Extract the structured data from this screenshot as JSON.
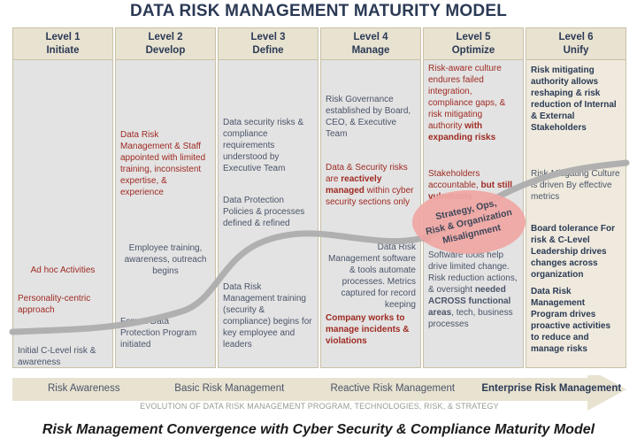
{
  "title": "DATA RISK MANAGEMENT MATURITY MODEL",
  "footer": "Risk Management Convergence with Cyber Security & Compliance Maturity Model",
  "colors": {
    "header_bg": "#e8e2d0",
    "cell_bg": "#e3e3e3",
    "last_cell_bg": "#efeadd",
    "border": "#c9c0a6",
    "navy": "#2b3a55",
    "red": "#9e2a22",
    "gray_text": "#4a5468",
    "ellipse": "#f0a7a4",
    "curve": "#b0b0b0",
    "arrow_bg": "#e8e2d0"
  },
  "columns": [
    {
      "level": "Level 1",
      "name": "Initiate",
      "blocks": [
        {
          "text": "Ad hoc Activities",
          "style": "red",
          "align": "center"
        },
        {
          "text": "Personality-centric approach",
          "style": "red",
          "align": "left"
        },
        {
          "text": "Initial C-Level risk & awareness",
          "style": "gray",
          "align": "left"
        }
      ]
    },
    {
      "level": "Level 2",
      "name": "Develop",
      "blocks": [
        {
          "text": "Data Risk Management & Staff appointed with limited training, inconsistent expertise, & experience",
          "style": "red",
          "align": "left"
        },
        {
          "text": "Employee training, awareness, outreach begins",
          "style": "gray",
          "align": "center"
        },
        {
          "text": "Formal Data Protection Program initiated",
          "style": "gray",
          "align": "left"
        }
      ]
    },
    {
      "level": "Level 3",
      "name": "Define",
      "blocks": [
        {
          "text": "Data  security risks & compliance requirements understood by Executive Team",
          "style": "gray",
          "align": "left"
        },
        {
          "text": "Data Protection Policies & processes defined & refined",
          "style": "gray",
          "align": "left"
        },
        {
          "text": "Data Risk Management training (security & compliance) begins for key employee and leaders",
          "style": "gray",
          "align": "left"
        }
      ]
    },
    {
      "level": "Level 4",
      "name": "Manage",
      "blocks": [
        {
          "text": "Risk Governance established by Board, CEO, & Executive Team",
          "style": "gray",
          "align": "left"
        },
        {
          "html": "Data & Security risks are <b>reactively managed</b> within cyber security sections only",
          "style": "red",
          "align": "left"
        },
        {
          "text": "Data Risk Management software & tools automate processes. Metrics captured for record keeping",
          "style": "gray",
          "align": "right"
        },
        {
          "text": "Company works to manage incidents & violations",
          "style": "red-bold",
          "align": "left"
        }
      ]
    },
    {
      "level": "Level 5",
      "name": "Optimize",
      "blocks": [
        {
          "html": "Risk-aware culture endures failed integration, compliance gaps, & risk mitigating authority <b>with expanding risks</b>",
          "style": "red",
          "align": "left"
        },
        {
          "html": "Stakeholders accountable, <b>but still vulnerable</b>",
          "style": "red",
          "align": "left"
        },
        {
          "html": "Software tools help drive limited change. Risk reduction actions, &amp; oversight <b>needed ACROSS functional areas</b>, tech, business processes",
          "style": "gray",
          "align": "left"
        }
      ]
    },
    {
      "level": "Level 6",
      "name": "Unify",
      "blocks": [
        {
          "text": "Risk mitigating authority allows reshaping & risk reduction of Internal & External Stakeholders",
          "style": "navy-bold",
          "align": "left"
        },
        {
          "text": "Risk-Mitigating Culture is driven By effective metrics",
          "style": "gray",
          "align": "left"
        },
        {
          "text": "Board tolerance For risk & C-Level Leadership drives changes across organization",
          "style": "navy-bold",
          "align": "left"
        },
        {
          "text": "Data Risk Management Program drives proactive activities to reduce and manage risks",
          "style": "navy-bold",
          "align": "left"
        }
      ]
    }
  ],
  "ellipse": {
    "line1": "Strategy, Ops,",
    "line2": "Risk & Organization",
    "line3": "Misalignment"
  },
  "arrow": {
    "labels": [
      {
        "text": "Risk Awareness",
        "bold": false
      },
      {
        "text": "Basic Risk Management",
        "bold": false
      },
      {
        "text": "Reactive Risk Management",
        "bold": false
      },
      {
        "text": "Enterprise Risk Management",
        "bold": true
      }
    ],
    "caption": "EVOLUTION OF DATA RISK MANAGEMENT PROGRAM, TECHNOLOGIES, RISK, & STRATEGY"
  }
}
